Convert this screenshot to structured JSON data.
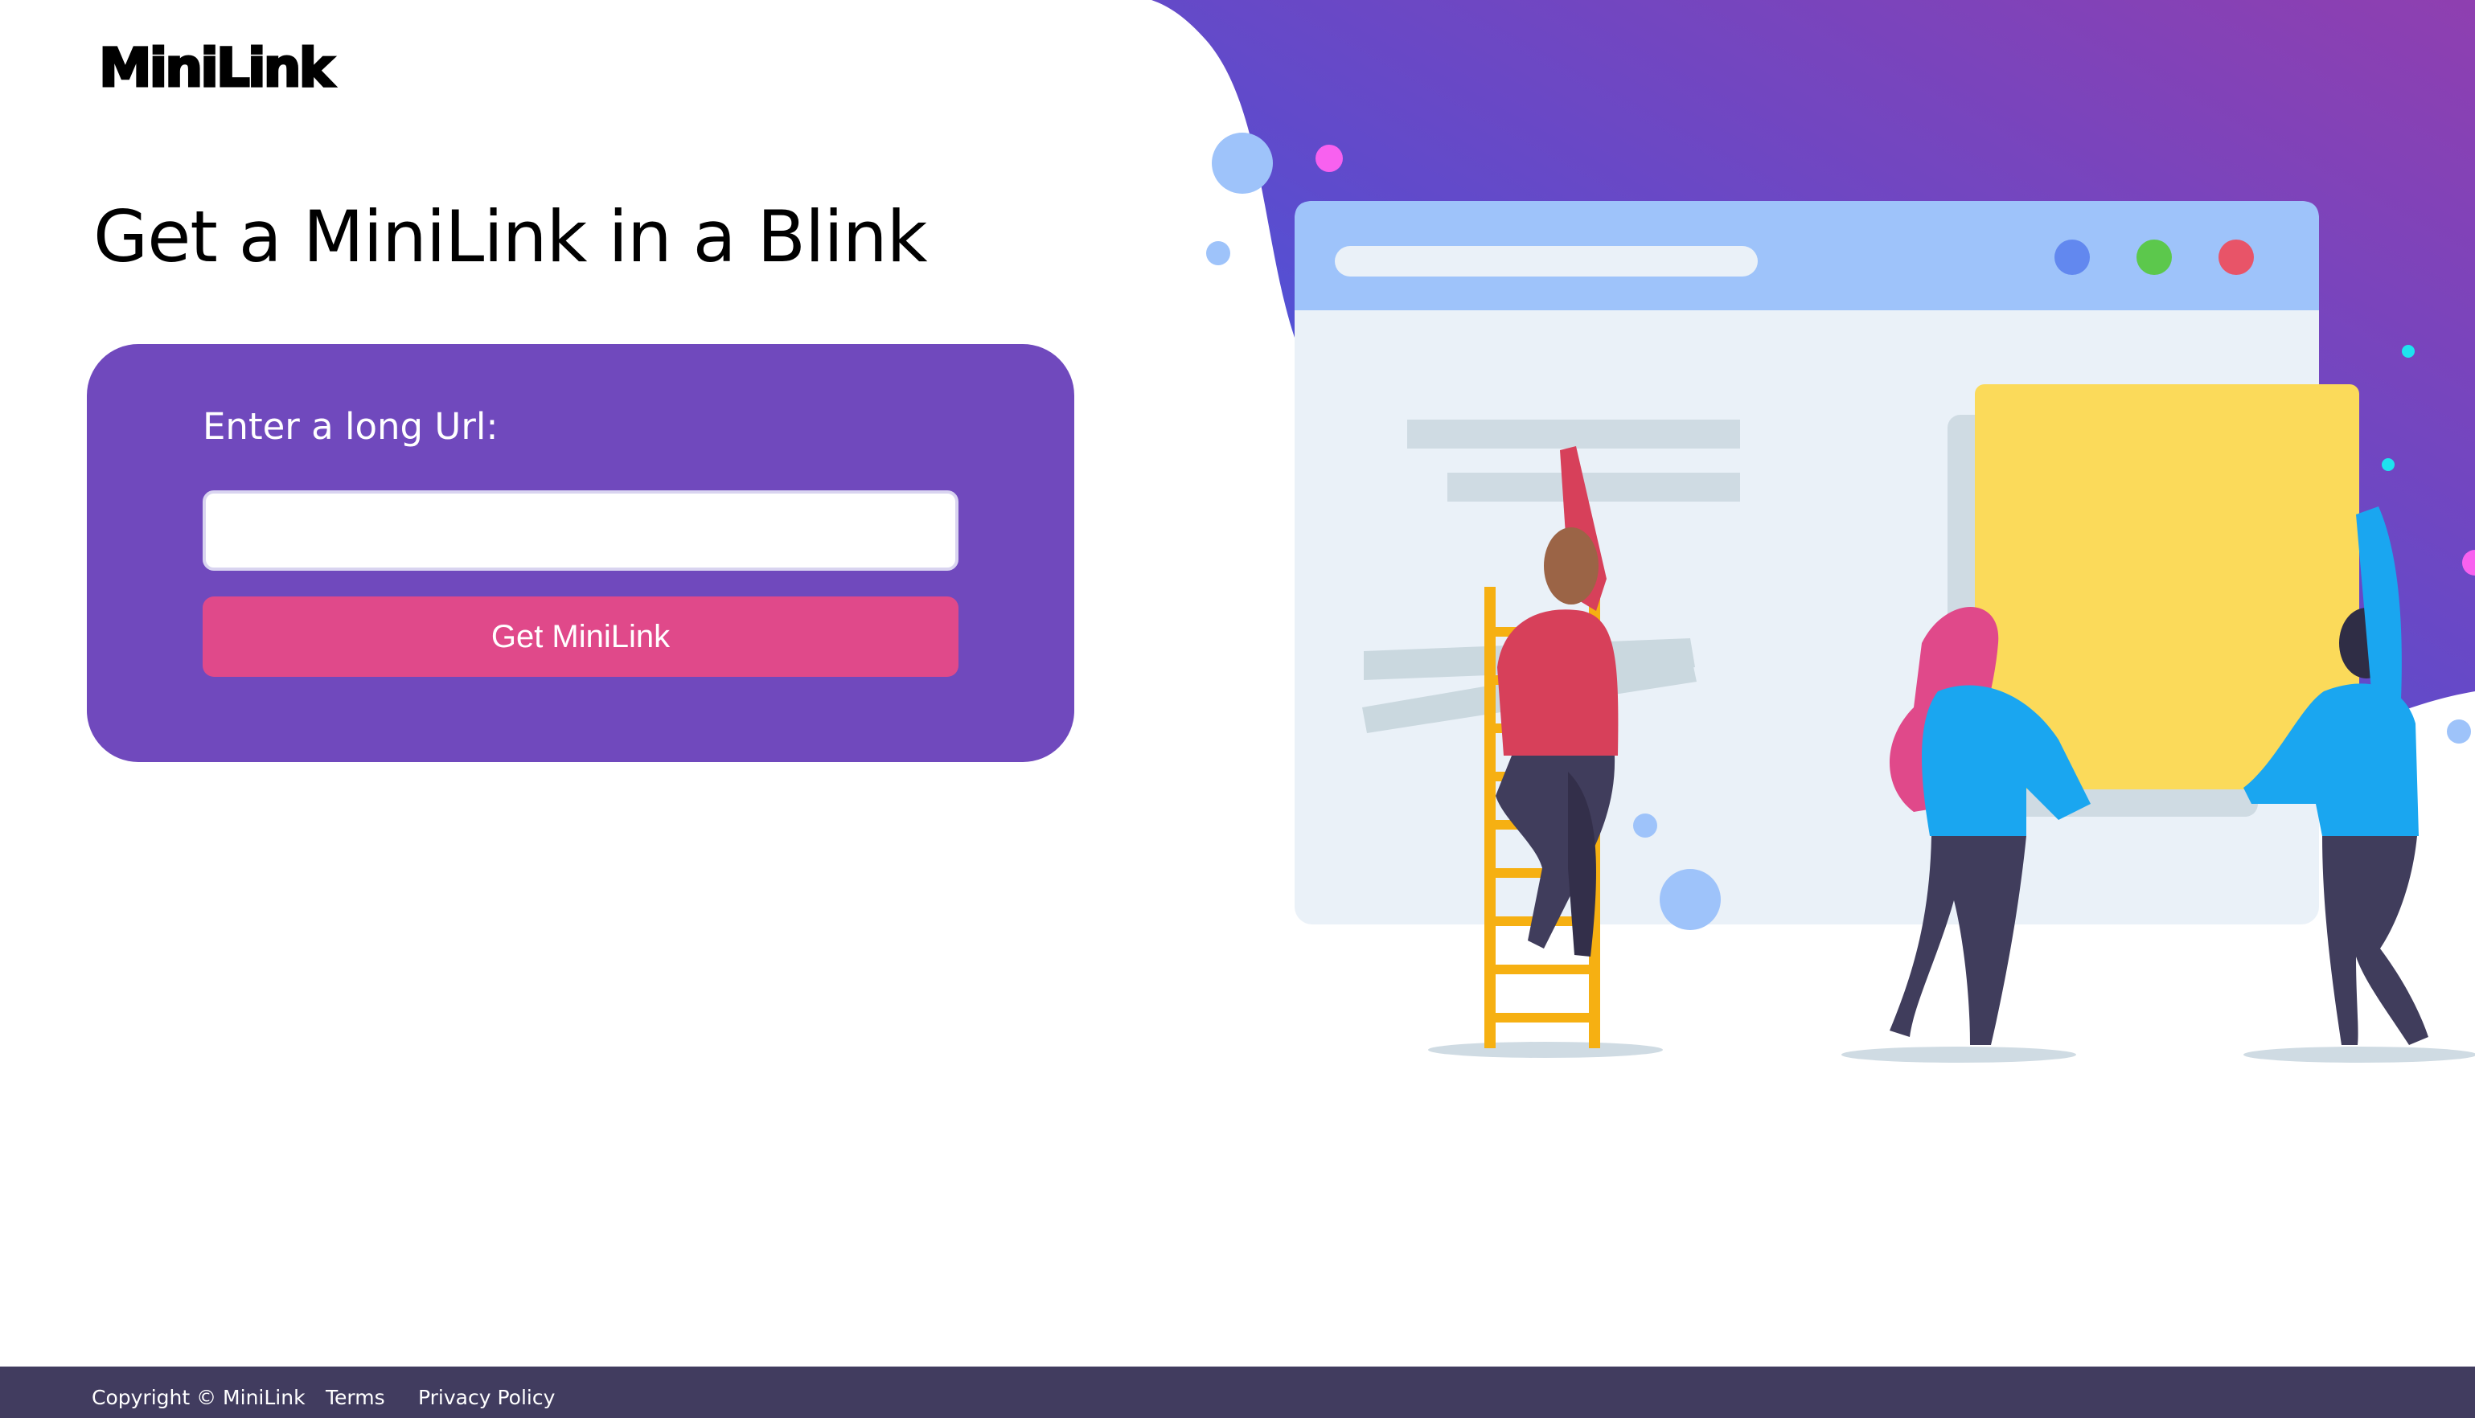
{
  "brand": {
    "logo_text": "MiniLink"
  },
  "hero": {
    "headline": "Get a MiniLink in a Blink"
  },
  "form": {
    "label": "Enter a long Url:",
    "input_value": "",
    "input_placeholder": "",
    "submit_label": "Get MiniLink"
  },
  "illustration": {
    "subject": "people-building-web-page-icon",
    "colors": {
      "gradient_start": "#3b5ee8",
      "gradient_end": "#8f3fb0",
      "window_bar": "#9ec3fa",
      "window_body": "#eaf1f8",
      "sticky_note": "#fbda5a",
      "ladder": "#f6b012"
    }
  },
  "footer": {
    "copyright": "Copyright © MiniLink",
    "terms": "Terms",
    "privacy": "Privacy Policy"
  },
  "colors": {
    "card_bg": "#7049bd",
    "button_bg": "#e0498a",
    "footer_bg": "#413c5f",
    "text_dark": "#000000",
    "text_light": "#ffffff"
  }
}
